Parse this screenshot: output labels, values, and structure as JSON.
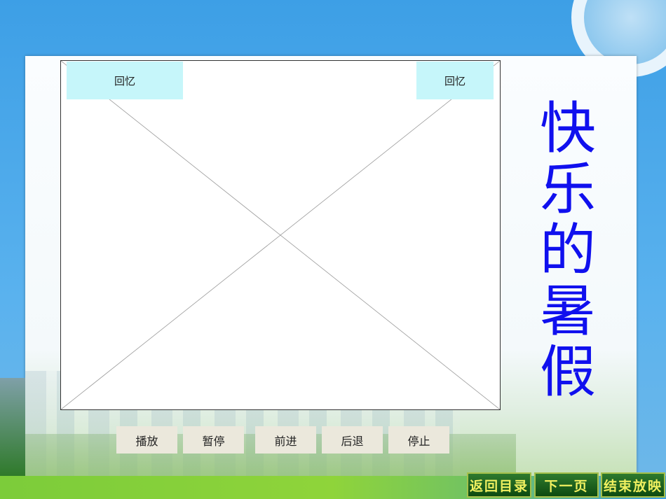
{
  "video": {
    "recall_left": "回忆",
    "recall_right": "回忆"
  },
  "title": "快乐的暑假",
  "controls": [
    "播放",
    "暂停",
    "前进",
    "后退",
    "停止"
  ],
  "nav": {
    "back_to_menu": "返回目录",
    "next_page": "下一页",
    "end_show": "结束放映"
  }
}
